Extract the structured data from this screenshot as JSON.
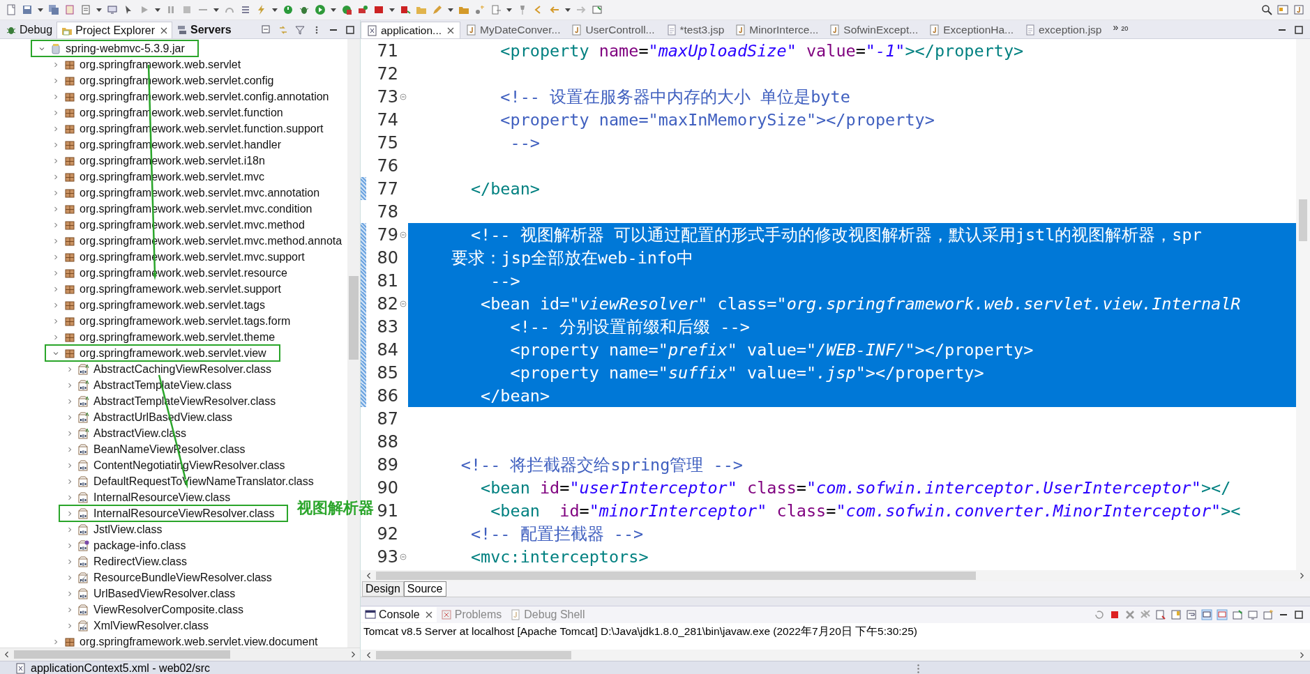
{
  "left_tabs": [
    {
      "label": "Debug",
      "kind": "debug",
      "selected": false,
      "bold": false
    },
    {
      "label": "Project Explorer",
      "kind": "explorer",
      "selected": true,
      "bold": false
    },
    {
      "label": "Servers",
      "kind": "servers",
      "selected": false,
      "bold": true
    }
  ],
  "tree": [
    {
      "kind": "jar",
      "label": "spring-webmvc-5.3.9.jar",
      "expanded": true,
      "boxed": true,
      "children": [
        {
          "kind": "package",
          "label": "org.springframework.web.servlet",
          "expanded": false,
          "boxed": false
        },
        {
          "kind": "package",
          "label": "org.springframework.web.servlet.config",
          "expanded": false,
          "boxed": false
        },
        {
          "kind": "package",
          "label": "org.springframework.web.servlet.config.annotation",
          "expanded": false,
          "boxed": false
        },
        {
          "kind": "package",
          "label": "org.springframework.web.servlet.function",
          "expanded": false,
          "boxed": false
        },
        {
          "kind": "package",
          "label": "org.springframework.web.servlet.function.support",
          "expanded": false,
          "boxed": false
        },
        {
          "kind": "package",
          "label": "org.springframework.web.servlet.handler",
          "expanded": false,
          "boxed": false
        },
        {
          "kind": "package",
          "label": "org.springframework.web.servlet.i18n",
          "expanded": false,
          "boxed": false
        },
        {
          "kind": "package",
          "label": "org.springframework.web.servlet.mvc",
          "expanded": false,
          "boxed": false
        },
        {
          "kind": "package",
          "label": "org.springframework.web.servlet.mvc.annotation",
          "expanded": false,
          "boxed": false
        },
        {
          "kind": "package",
          "label": "org.springframework.web.servlet.mvc.condition",
          "expanded": false,
          "boxed": false
        },
        {
          "kind": "package",
          "label": "org.springframework.web.servlet.mvc.method",
          "expanded": false,
          "boxed": false
        },
        {
          "kind": "package",
          "label": "org.springframework.web.servlet.mvc.method.annota",
          "expanded": false,
          "boxed": false
        },
        {
          "kind": "package",
          "label": "org.springframework.web.servlet.mvc.support",
          "expanded": false,
          "boxed": false
        },
        {
          "kind": "package",
          "label": "org.springframework.web.servlet.resource",
          "expanded": false,
          "boxed": false
        },
        {
          "kind": "package",
          "label": "org.springframework.web.servlet.support",
          "expanded": false,
          "boxed": false
        },
        {
          "kind": "package",
          "label": "org.springframework.web.servlet.tags",
          "expanded": false,
          "boxed": false
        },
        {
          "kind": "package",
          "label": "org.springframework.web.servlet.tags.form",
          "expanded": false,
          "boxed": false
        },
        {
          "kind": "package",
          "label": "org.springframework.web.servlet.theme",
          "expanded": false,
          "boxed": false
        },
        {
          "kind": "package",
          "label": "org.springframework.web.servlet.view",
          "expanded": true,
          "boxed": true,
          "children": [
            {
              "kind": "abstract_class",
              "label": "AbstractCachingViewResolver.class",
              "expanded": false,
              "boxed": false
            },
            {
              "kind": "abstract_class",
              "label": "AbstractTemplateView.class",
              "expanded": false,
              "boxed": false
            },
            {
              "kind": "abstract_class",
              "label": "AbstractTemplateViewResolver.class",
              "expanded": false,
              "boxed": false
            },
            {
              "kind": "abstract_class",
              "label": "AbstractUrlBasedView.class",
              "expanded": false,
              "boxed": false
            },
            {
              "kind": "abstract_class",
              "label": "AbstractView.class",
              "expanded": false,
              "boxed": false
            },
            {
              "kind": "class",
              "label": "BeanNameViewResolver.class",
              "expanded": false,
              "boxed": false
            },
            {
              "kind": "class",
              "label": "ContentNegotiatingViewResolver.class",
              "expanded": false,
              "boxed": false
            },
            {
              "kind": "class",
              "label": "DefaultRequestToViewNameTranslator.class",
              "expanded": false,
              "boxed": false
            },
            {
              "kind": "class",
              "label": "InternalResourceView.class",
              "expanded": false,
              "boxed": false
            },
            {
              "kind": "class",
              "label": "InternalResourceViewResolver.class",
              "expanded": false,
              "boxed": true
            },
            {
              "kind": "class",
              "label": "JstlView.class",
              "expanded": false,
              "boxed": false
            },
            {
              "kind": "package_info",
              "label": "package-info.class",
              "expanded": false,
              "boxed": false
            },
            {
              "kind": "class",
              "label": "RedirectView.class",
              "expanded": false,
              "boxed": false
            },
            {
              "kind": "deprecated_class",
              "label": "ResourceBundleViewResolver.class",
              "expanded": false,
              "boxed": false
            },
            {
              "kind": "class",
              "label": "UrlBasedViewResolver.class",
              "expanded": false,
              "boxed": false
            },
            {
              "kind": "class",
              "label": "ViewResolverComposite.class",
              "expanded": false,
              "boxed": false
            },
            {
              "kind": "deprecated_class",
              "label": "XmlViewResolver.class",
              "expanded": false,
              "boxed": false
            }
          ]
        },
        {
          "kind": "package",
          "label": "org.springframework.web.servlet.view.document",
          "expanded": false,
          "boxed": false
        }
      ]
    }
  ],
  "annotation_label": "视图解析器",
  "editor_tabs": [
    {
      "label": "application...",
      "kind": "xml",
      "selected": true
    },
    {
      "label": "MyDateConver...",
      "kind": "java",
      "selected": false
    },
    {
      "label": "UserControll...",
      "kind": "java",
      "selected": false
    },
    {
      "label": "*test3.jsp",
      "kind": "jsp",
      "selected": false
    },
    {
      "label": "MinorInterce...",
      "kind": "java",
      "selected": false
    },
    {
      "label": "SofwinExcept...",
      "kind": "java",
      "selected": false
    },
    {
      "label": "ExceptionHa...",
      "kind": "java",
      "selected": false
    },
    {
      "label": "exception.jsp",
      "kind": "jsp",
      "selected": false
    }
  ],
  "more_tabs": "»",
  "more_tabs_count": "20",
  "code_lines": [
    {
      "number": "71",
      "fold": false,
      "changed": false,
      "selected": false,
      "parts": [
        {
          "kind": "tag",
          "text": "         <property"
        },
        {
          "kind": "attr",
          "text": " name"
        },
        {
          "kind": "text",
          "text": "="
        },
        {
          "kind": "value",
          "text": "\"maxUploadSize\""
        },
        {
          "kind": "attr",
          "text": " value"
        },
        {
          "kind": "text",
          "text": "="
        },
        {
          "kind": "value",
          "text": "\"-1\""
        },
        {
          "kind": "tag",
          "text": "></property>"
        }
      ]
    },
    {
      "number": "72",
      "fold": false,
      "changed": false,
      "selected": false
    },
    {
      "number": "73",
      "fold": true,
      "changed": false,
      "selected": false,
      "parts": [
        {
          "kind": "comment",
          "text": "         <!-- 设置在服务器中内存的大小 单位是byte"
        }
      ]
    },
    {
      "number": "74",
      "fold": false,
      "changed": false,
      "selected": false,
      "parts": [
        {
          "kind": "comment",
          "text": "         <property name=\"maxInMemorySize\"></property>"
        }
      ]
    },
    {
      "number": "75",
      "fold": false,
      "changed": false,
      "selected": false,
      "parts": [
        {
          "kind": "comment",
          "text": "          -->"
        }
      ]
    },
    {
      "number": "76",
      "fold": false,
      "changed": false,
      "selected": false
    },
    {
      "number": "77",
      "fold": false,
      "changed": true,
      "selected": false,
      "parts": [
        {
          "kind": "tag",
          "text": "      </bean>"
        }
      ]
    },
    {
      "number": "78",
      "fold": false,
      "changed": false,
      "selected": false
    },
    {
      "number": "79",
      "fold": true,
      "changed": true,
      "selected": true,
      "parts": [
        {
          "kind": "comment",
          "text": "      <!-- 视图解析器 可以通过配置的形式手动的修改视图解析器，默认采用jstl的视图解析器，spr"
        }
      ]
    },
    {
      "number": "80",
      "fold": false,
      "changed": true,
      "selected": true,
      "parts": [
        {
          "kind": "comment",
          "text": "    要求：jsp全部放在web-info中"
        }
      ]
    },
    {
      "number": "81",
      "fold": false,
      "changed": true,
      "selected": true,
      "parts": [
        {
          "kind": "comment",
          "text": "        -->"
        }
      ]
    },
    {
      "number": "82",
      "fold": true,
      "changed": true,
      "selected": true,
      "parts": [
        {
          "kind": "tag",
          "text": "       <bean"
        },
        {
          "kind": "attr",
          "text": " id"
        },
        {
          "kind": "text",
          "text": "="
        },
        {
          "kind": "value",
          "text": "\"viewResolver\""
        },
        {
          "kind": "attr",
          "text": " class"
        },
        {
          "kind": "text",
          "text": "="
        },
        {
          "kind": "value",
          "text": "\"org.springframework.web.servlet.view.InternalR"
        }
      ]
    },
    {
      "number": "83",
      "fold": false,
      "changed": true,
      "selected": true,
      "parts": [
        {
          "kind": "comment",
          "text": "          <!-- 分别设置前缀和后缀 -->"
        }
      ]
    },
    {
      "number": "84",
      "fold": false,
      "changed": true,
      "selected": true,
      "parts": [
        {
          "kind": "tag",
          "text": "          <property"
        },
        {
          "kind": "attr",
          "text": " name"
        },
        {
          "kind": "text",
          "text": "="
        },
        {
          "kind": "value",
          "text": "\"prefix\""
        },
        {
          "kind": "attr",
          "text": " value"
        },
        {
          "kind": "text",
          "text": "="
        },
        {
          "kind": "value",
          "text": "\"/WEB-INF/\""
        },
        {
          "kind": "tag",
          "text": "></property>"
        }
      ]
    },
    {
      "number": "85",
      "fold": false,
      "changed": true,
      "selected": true,
      "parts": [
        {
          "kind": "tag",
          "text": "          <property"
        },
        {
          "kind": "attr",
          "text": " name"
        },
        {
          "kind": "text",
          "text": "="
        },
        {
          "kind": "value",
          "text": "\"suffix\""
        },
        {
          "kind": "attr",
          "text": " value"
        },
        {
          "kind": "text",
          "text": "="
        },
        {
          "kind": "value",
          "text": "\".jsp\""
        },
        {
          "kind": "tag",
          "text": "></property>"
        }
      ]
    },
    {
      "number": "86",
      "fold": false,
      "changed": true,
      "selected": true,
      "parts": [
        {
          "kind": "tag",
          "text": "       </bean>"
        }
      ]
    },
    {
      "number": "87",
      "fold": false,
      "changed": false,
      "selected": false
    },
    {
      "number": "88",
      "fold": false,
      "changed": false,
      "selected": false
    },
    {
      "number": "89",
      "fold": false,
      "changed": false,
      "selected": false,
      "parts": [
        {
          "kind": "comment",
          "text": "     <!-- 将拦截器交给spring管理 -->"
        }
      ]
    },
    {
      "number": "90",
      "fold": false,
      "changed": false,
      "selected": false,
      "parts": [
        {
          "kind": "tag",
          "text": "       <bean"
        },
        {
          "kind": "attr",
          "text": " id"
        },
        {
          "kind": "text",
          "text": "="
        },
        {
          "kind": "value",
          "text": "\"userInterceptor\""
        },
        {
          "kind": "attr",
          "text": " class"
        },
        {
          "kind": "text",
          "text": "="
        },
        {
          "kind": "value",
          "text": "\"com.sofwin.interceptor.UserInterceptor\""
        },
        {
          "kind": "tag",
          "text": "></"
        }
      ]
    },
    {
      "number": "91",
      "fold": false,
      "changed": false,
      "selected": false,
      "parts": [
        {
          "kind": "tag",
          "text": "        <bean"
        },
        {
          "kind": "attr",
          "text": "  id"
        },
        {
          "kind": "text",
          "text": "="
        },
        {
          "kind": "value",
          "text": "\"minorInterceptor\""
        },
        {
          "kind": "attr",
          "text": " class"
        },
        {
          "kind": "text",
          "text": "="
        },
        {
          "kind": "value",
          "text": "\"com.sofwin.converter.MinorInterceptor\""
        },
        {
          "kind": "tag",
          "text": "><"
        }
      ]
    },
    {
      "number": "92",
      "fold": false,
      "changed": false,
      "selected": false,
      "parts": [
        {
          "kind": "comment",
          "text": "      <!-- 配置拦截器 -->"
        }
      ]
    },
    {
      "number": "93",
      "fold": true,
      "changed": false,
      "selected": false,
      "parts": [
        {
          "kind": "tag",
          "text": "      <mvc:interceptors>"
        }
      ]
    }
  ],
  "editor_mode_tabs": [
    {
      "label": "Design",
      "selected": false
    },
    {
      "label": "Source",
      "selected": true
    }
  ],
  "console_tabs": [
    {
      "label": "Console",
      "kind": "console",
      "selected": true
    },
    {
      "label": "Problems",
      "kind": "problems",
      "selected": false
    },
    {
      "label": "Debug Shell",
      "kind": "shell",
      "selected": false
    }
  ],
  "console_header": "Tomcat v8.5 Server at localhost [Apache Tomcat] D:\\Java\\jdk1.8.0_281\\bin\\javaw.exe  (2022年7月20日 下午5:30:25)",
  "status_bar": {
    "text": "applicationContext5.xml - web02/src"
  }
}
